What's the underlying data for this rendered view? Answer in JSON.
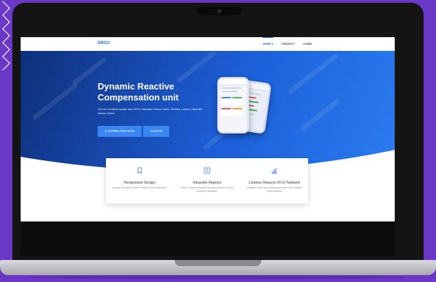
{
  "nav": {
    "logo": "DRCU",
    "links": [
      {
        "label": "HOME ▾",
        "active": true
      },
      {
        "label": "CONTACT",
        "active": false
      },
      {
        "label": "LOGIN",
        "active": false
      }
    ]
  },
  "hero": {
    "title": "Dynamic Reactive Compensation unit",
    "subtitle": "Get the Greatest Insight with DRCU Maintain Power Factor, Reduce Losses, Read the Values Online",
    "download_label": "⬇ DOWNLOAD NOW",
    "login_label": "➜LOGIN"
  },
  "features": [
    {
      "icon": "bookmark-icon",
      "title": "Responsive Design",
      "desc": "Access through all kind of devices from anywhere"
    },
    {
      "icon": "report-icon",
      "title": "Intractive Reports",
      "desc": "Every Detailed Reports including Injected KVAR Report is available"
    },
    {
      "icon": "bar-chart-icon",
      "title": "Lineless Reports Of LV Network",
      "desc": "Lineless report with actual load,active and reactive compensation"
    }
  ],
  "colors": {
    "accent": "#1b5fd9",
    "button": "#3a86f2",
    "background": "#6b37c7"
  }
}
